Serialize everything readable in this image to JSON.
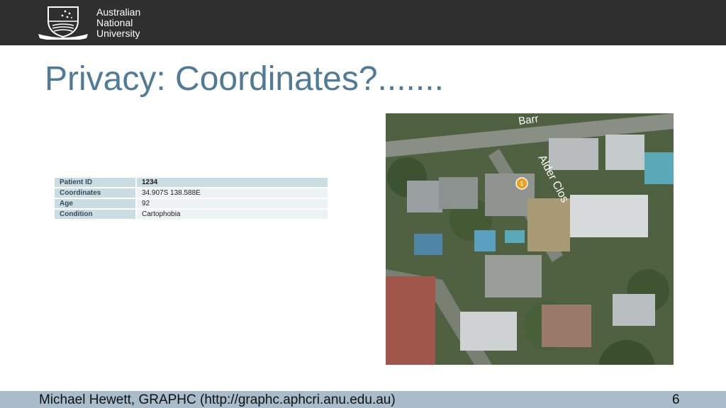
{
  "header": {
    "university_name": [
      "Australian",
      "National",
      "University"
    ]
  },
  "slide": {
    "title": "Privacy: Coordinates?.......",
    "table": [
      {
        "key": "Patient ID",
        "value": "1234"
      },
      {
        "key": "Coordinates",
        "value": "34.907S 138.588E"
      },
      {
        "key": "Age",
        "value": "92"
      },
      {
        "key": "Condition",
        "value": "Cartophobia"
      }
    ],
    "map": {
      "street_label_1": "Alder Clos",
      "street_label_2": "Barr",
      "marker_label": "1"
    }
  },
  "footer": {
    "credit": "Michael Hewett, GRAPHC (http://graphc.aphcri.anu.edu.au)",
    "page_number": "6"
  },
  "colors": {
    "title": "#4f7b98",
    "header_bg": "#2f2f2f",
    "footer_bg": "#a9bccb",
    "marker": "#f0a01e"
  }
}
